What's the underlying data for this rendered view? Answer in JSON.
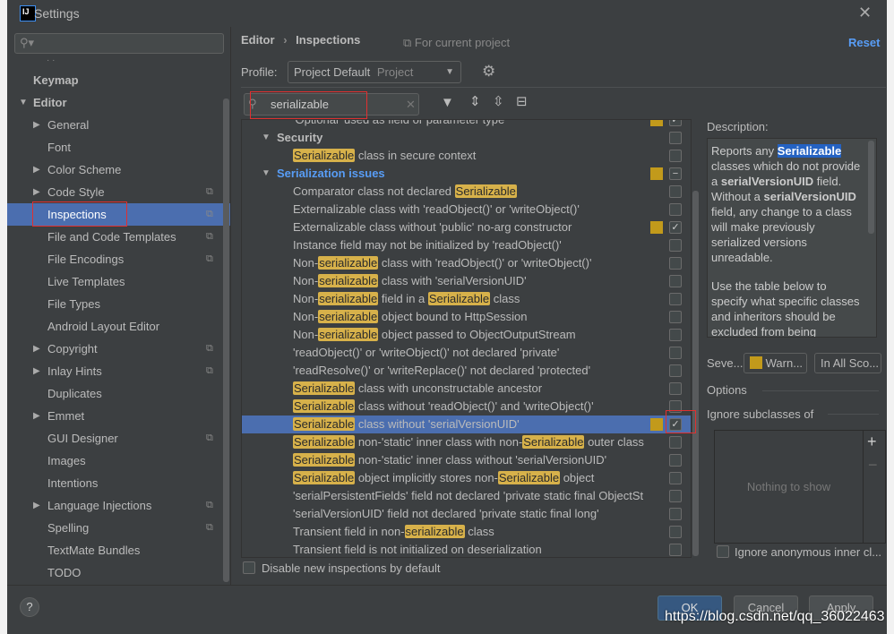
{
  "window": {
    "title": "Settings",
    "logo": "IJ"
  },
  "sidebar": {
    "search_placeholder": "",
    "items": [
      {
        "label": "Keymap",
        "level": 0,
        "bold": true
      },
      {
        "label": "Editor",
        "level": 0,
        "bold": true,
        "expanded": true
      },
      {
        "label": "General",
        "level": 1,
        "arrow": true
      },
      {
        "label": "Font",
        "level": 1
      },
      {
        "label": "Color Scheme",
        "level": 1,
        "arrow": true
      },
      {
        "label": "Code Style",
        "level": 1,
        "arrow": true,
        "copy": true
      },
      {
        "label": "Inspections",
        "level": 1,
        "copy": true,
        "selected": true
      },
      {
        "label": "File and Code Templates",
        "level": 1,
        "copy": true
      },
      {
        "label": "File Encodings",
        "level": 1,
        "copy": true
      },
      {
        "label": "Live Templates",
        "level": 1
      },
      {
        "label": "File Types",
        "level": 1
      },
      {
        "label": "Android Layout Editor",
        "level": 1
      },
      {
        "label": "Copyright",
        "level": 1,
        "arrow": true,
        "copy": true
      },
      {
        "label": "Inlay Hints",
        "level": 1,
        "arrow": true,
        "copy": true
      },
      {
        "label": "Duplicates",
        "level": 1
      },
      {
        "label": "Emmet",
        "level": 1,
        "arrow": true
      },
      {
        "label": "GUI Designer",
        "level": 1,
        "copy": true
      },
      {
        "label": "Images",
        "level": 1
      },
      {
        "label": "Intentions",
        "level": 1
      },
      {
        "label": "Language Injections",
        "level": 1,
        "arrow": true,
        "copy": true
      },
      {
        "label": "Spelling",
        "level": 1,
        "copy": true
      },
      {
        "label": "TextMate Bundles",
        "level": 1
      },
      {
        "label": "TODO",
        "level": 1
      }
    ]
  },
  "header": {
    "breadcrumb": [
      "Editor",
      "Inspections"
    ],
    "scope": "For current project",
    "reset": "Reset"
  },
  "profile": {
    "label": "Profile:",
    "value": "Project Default",
    "sub": "Project"
  },
  "filter": {
    "value": "serializable"
  },
  "list": [
    {
      "parts": [
        [
          "'Optional' used as field or parameter type",
          0
        ]
      ],
      "indent": 2,
      "sev": true,
      "check": "checked"
    },
    {
      "parts": [
        [
          "Security",
          0
        ]
      ],
      "group": true,
      "check": "unchecked"
    },
    {
      "parts": [
        [
          "Serializable",
          1
        ],
        [
          " class in secure context",
          0
        ]
      ],
      "indent": 2,
      "check": "unchecked"
    },
    {
      "parts": [
        [
          "Serialization issues",
          0
        ]
      ],
      "group": true,
      "blue": true,
      "sev": true,
      "check": "mixed"
    },
    {
      "parts": [
        [
          "Comparator class not declared ",
          0
        ],
        [
          "Serializable",
          1
        ]
      ],
      "indent": 2,
      "check": "unchecked"
    },
    {
      "parts": [
        [
          "Externalizable class with 'readObject()' or 'writeObject()'",
          0
        ]
      ],
      "indent": 2,
      "check": "unchecked"
    },
    {
      "parts": [
        [
          "Externalizable class without 'public' no-arg constructor",
          0
        ]
      ],
      "indent": 2,
      "sev": true,
      "check": "checked"
    },
    {
      "parts": [
        [
          "Instance field may not be initialized by 'readObject()'",
          0
        ]
      ],
      "indent": 2,
      "check": "unchecked"
    },
    {
      "parts": [
        [
          "Non-",
          0
        ],
        [
          "serializable",
          1
        ],
        [
          " class with 'readObject()' or 'writeObject()'",
          0
        ]
      ],
      "indent": 2,
      "check": "unchecked"
    },
    {
      "parts": [
        [
          "Non-",
          0
        ],
        [
          "serializable",
          1
        ],
        [
          " class with 'serialVersionUID'",
          0
        ]
      ],
      "indent": 2,
      "check": "unchecked"
    },
    {
      "parts": [
        [
          "Non-",
          0
        ],
        [
          "serializable",
          1
        ],
        [
          " field in a ",
          0
        ],
        [
          "Serializable",
          1
        ],
        [
          " class",
          0
        ]
      ],
      "indent": 2,
      "check": "unchecked"
    },
    {
      "parts": [
        [
          "Non-",
          0
        ],
        [
          "serializable",
          1
        ],
        [
          " object bound to HttpSession",
          0
        ]
      ],
      "indent": 2,
      "check": "unchecked"
    },
    {
      "parts": [
        [
          "Non-",
          0
        ],
        [
          "serializable",
          1
        ],
        [
          " object passed to ObjectOutputStream",
          0
        ]
      ],
      "indent": 2,
      "check": "unchecked"
    },
    {
      "parts": [
        [
          "'readObject()' or 'writeObject()' not declared 'private'",
          0
        ]
      ],
      "indent": 2,
      "check": "unchecked"
    },
    {
      "parts": [
        [
          "'readResolve()' or 'writeReplace()' not declared 'protected'",
          0
        ]
      ],
      "indent": 2,
      "check": "unchecked"
    },
    {
      "parts": [
        [
          "Serializable",
          1
        ],
        [
          " class with unconstructable ancestor",
          0
        ]
      ],
      "indent": 2,
      "check": "unchecked"
    },
    {
      "parts": [
        [
          "Serializable",
          1
        ],
        [
          " class without 'readObject()' and 'writeObject()'",
          0
        ]
      ],
      "indent": 2,
      "check": "unchecked"
    },
    {
      "parts": [
        [
          "Serializable",
          1
        ],
        [
          " class without 'serialVersionUID'",
          0
        ]
      ],
      "indent": 2,
      "sev": true,
      "check": "checked",
      "selected": true
    },
    {
      "parts": [
        [
          "Serializable",
          1
        ],
        [
          " non-'static' inner class with non-",
          0
        ],
        [
          "Serializable",
          1
        ],
        [
          " outer class",
          0
        ]
      ],
      "indent": 2,
      "check": "unchecked"
    },
    {
      "parts": [
        [
          "Serializable",
          1
        ],
        [
          " non-'static' inner class without 'serialVersionUID'",
          0
        ]
      ],
      "indent": 2,
      "check": "unchecked"
    },
    {
      "parts": [
        [
          "Serializable",
          1
        ],
        [
          " object implicitly stores non-",
          0
        ],
        [
          "Serializable",
          1
        ],
        [
          " object",
          0
        ]
      ],
      "indent": 2,
      "check": "unchecked"
    },
    {
      "parts": [
        [
          "'serialPersistentFields' field not declared 'private static final ObjectSt",
          0
        ]
      ],
      "indent": 2,
      "check": "unchecked"
    },
    {
      "parts": [
        [
          "'serialVersionUID' field not declared 'private static final long'",
          0
        ]
      ],
      "indent": 2,
      "check": "unchecked"
    },
    {
      "parts": [
        [
          "Transient field in non-",
          0
        ],
        [
          "serializable",
          1
        ],
        [
          " class",
          0
        ]
      ],
      "indent": 2,
      "check": "unchecked"
    },
    {
      "parts": [
        [
          "Transient field is not initialized on deserialization",
          0
        ]
      ],
      "indent": 2,
      "check": "unchecked"
    }
  ],
  "disable_new": "Disable new inspections by default",
  "description": {
    "label": "Description:",
    "p1": [
      [
        "Reports any ",
        0
      ],
      [
        "Serializable",
        2
      ],
      [
        " classes which do not provide a ",
        0
      ],
      [
        "serialVersionUID",
        3
      ],
      [
        " field. Without a ",
        0
      ],
      [
        "serialVersionUID",
        3
      ],
      [
        " field, any change to a class will make previously serialized versions unreadable.",
        0
      ]
    ],
    "p2": "Use the table below to specify what specific classes and inheritors should be excluded from being"
  },
  "severity": {
    "label": "Seve...",
    "value": "Warn...",
    "scope": "In All Sco..."
  },
  "options": {
    "label": "Options",
    "ignore_subclasses": "Ignore subclasses of",
    "empty": "Nothing to show",
    "add": "+",
    "remove": "−",
    "ignore_anon": "Ignore anonymous inner cl..."
  },
  "buttons": {
    "ok": "OK",
    "cancel": "Cancel",
    "apply": "Apply",
    "help": "?"
  },
  "watermark": "https://blog.csdn.net/qq_36022463",
  "colors": {
    "bg": "#3c3f41",
    "selection": "#4b6eaf",
    "highlight": "#d7b14a",
    "warning": "#c29a1b",
    "link": "#589df6"
  }
}
